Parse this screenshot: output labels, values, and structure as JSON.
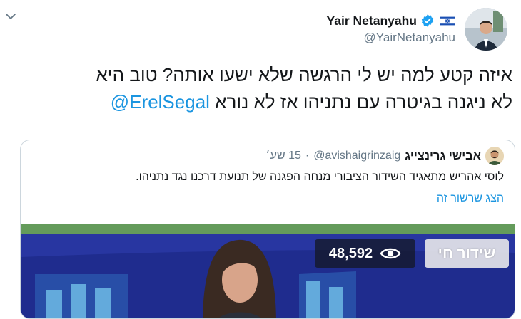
{
  "header": {
    "author_name": "Yair Netanyahu",
    "handle": "@YairNetanyahu",
    "verified": true,
    "icons": {
      "menu": "chevron-down-icon",
      "verified": "verified-badge-icon",
      "flag": "israel-flag-icon"
    }
  },
  "tweet": {
    "text_line1": "איזה קטע למה יש לי הרגשה שלא ישעו אותה? טוב היא",
    "text_line2_prefix": "לא ניגנה בגיטרה עם נתניהו אז לא נורא",
    "mention": "@ErelSegal"
  },
  "quoted": {
    "author_name": "אבישי גרינצייג",
    "handle": "@avishaigrinzaig",
    "separator": "·",
    "time": "15 שע׳",
    "text": "לוסי אהריש מתאגיד השידור הציבורי מנחה הפגנה של תנועת דרכנו נגד נתניהו.",
    "show_thread": "הצג שרשור זה",
    "media": {
      "views": "48,592",
      "live_label": "שידור חי"
    }
  },
  "colors": {
    "link": "#1b95e0",
    "secondary_text": "#657786",
    "border": "#ccd6dd",
    "video_background": "#1f2c8e"
  }
}
